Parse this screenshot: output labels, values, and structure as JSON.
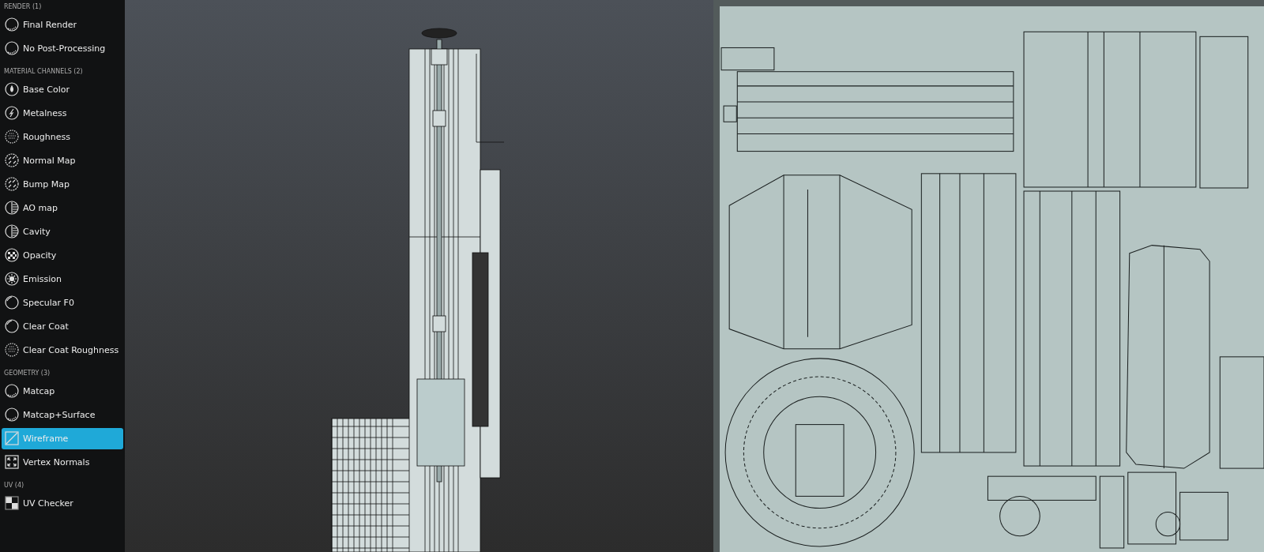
{
  "sidebar": {
    "sections": [
      {
        "title": "RENDER (1)",
        "items": [
          {
            "label": "Final Render",
            "kind": "sphere",
            "selected": false
          },
          {
            "label": "No Post-Processing",
            "kind": "sphere",
            "selected": false
          }
        ]
      },
      {
        "title": "MATERIAL CHANNELS (2)",
        "items": [
          {
            "label": "Base Color",
            "kind": "drop",
            "selected": false
          },
          {
            "label": "Metalness",
            "kind": "bolt",
            "selected": false
          },
          {
            "label": "Roughness",
            "kind": "dots",
            "selected": false
          },
          {
            "label": "Normal Map",
            "kind": "arrows",
            "selected": false
          },
          {
            "label": "Bump Map",
            "kind": "arrows",
            "selected": false
          },
          {
            "label": "AO map",
            "kind": "half",
            "selected": false
          },
          {
            "label": "Cavity",
            "kind": "half",
            "selected": false
          },
          {
            "label": "Opacity",
            "kind": "checker",
            "selected": false
          },
          {
            "label": "Emission",
            "kind": "sun",
            "selected": false
          },
          {
            "label": "Specular F0",
            "kind": "ring",
            "selected": false
          },
          {
            "label": "Clear Coat",
            "kind": "ring",
            "selected": false
          },
          {
            "label": "Clear Coat Roughness",
            "kind": "dots",
            "selected": false
          }
        ]
      },
      {
        "title": "GEOMETRY (3)",
        "items": [
          {
            "label": "Matcap",
            "kind": "sphere",
            "selected": false
          },
          {
            "label": "Matcap+Surface",
            "kind": "sphere",
            "selected": false
          },
          {
            "label": "Wireframe",
            "kind": "diagonal",
            "selected": true
          },
          {
            "label": "Vertex Normals",
            "kind": "expand",
            "selected": false
          }
        ]
      },
      {
        "title": "UV (4)",
        "items": [
          {
            "label": "UV Checker",
            "kind": "uvchecker",
            "selected": false
          }
        ]
      }
    ]
  }
}
